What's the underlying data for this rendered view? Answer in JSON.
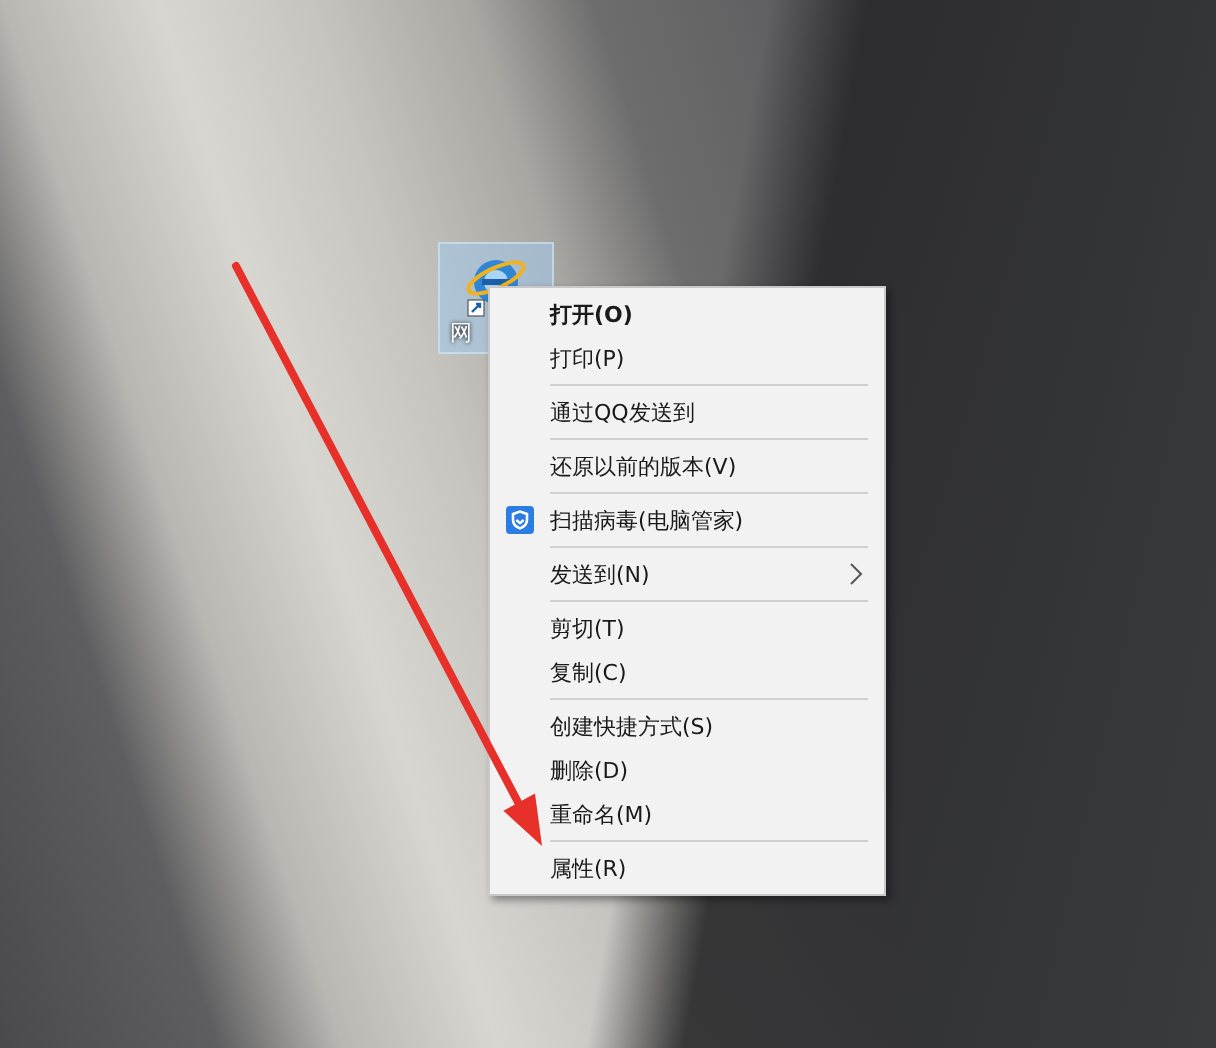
{
  "desktop_icon": {
    "label": "网",
    "selected": true
  },
  "context_menu": {
    "groups": [
      [
        {
          "label": "打开(O)",
          "kind": "plain",
          "default": true
        },
        {
          "label": "打印(P)",
          "kind": "plain",
          "default": false
        }
      ],
      [
        {
          "label": "通过QQ发送到",
          "kind": "plain",
          "default": false
        }
      ],
      [
        {
          "label": "还原以前的版本(V)",
          "kind": "plain",
          "default": false
        }
      ],
      [
        {
          "label": "扫描病毒(电脑管家)",
          "kind": "shield",
          "default": false
        }
      ],
      [
        {
          "label": "发送到(N)",
          "kind": "submenu",
          "default": false
        }
      ],
      [
        {
          "label": "剪切(T)",
          "kind": "plain",
          "default": false
        },
        {
          "label": "复制(C)",
          "kind": "plain",
          "default": false
        }
      ],
      [
        {
          "label": "创建快捷方式(S)",
          "kind": "plain",
          "default": false
        },
        {
          "label": "删除(D)",
          "kind": "plain",
          "default": false
        },
        {
          "label": "重命名(M)",
          "kind": "plain",
          "default": false
        }
      ],
      [
        {
          "label": "属性(R)",
          "kind": "plain",
          "default": false
        }
      ]
    ]
  }
}
